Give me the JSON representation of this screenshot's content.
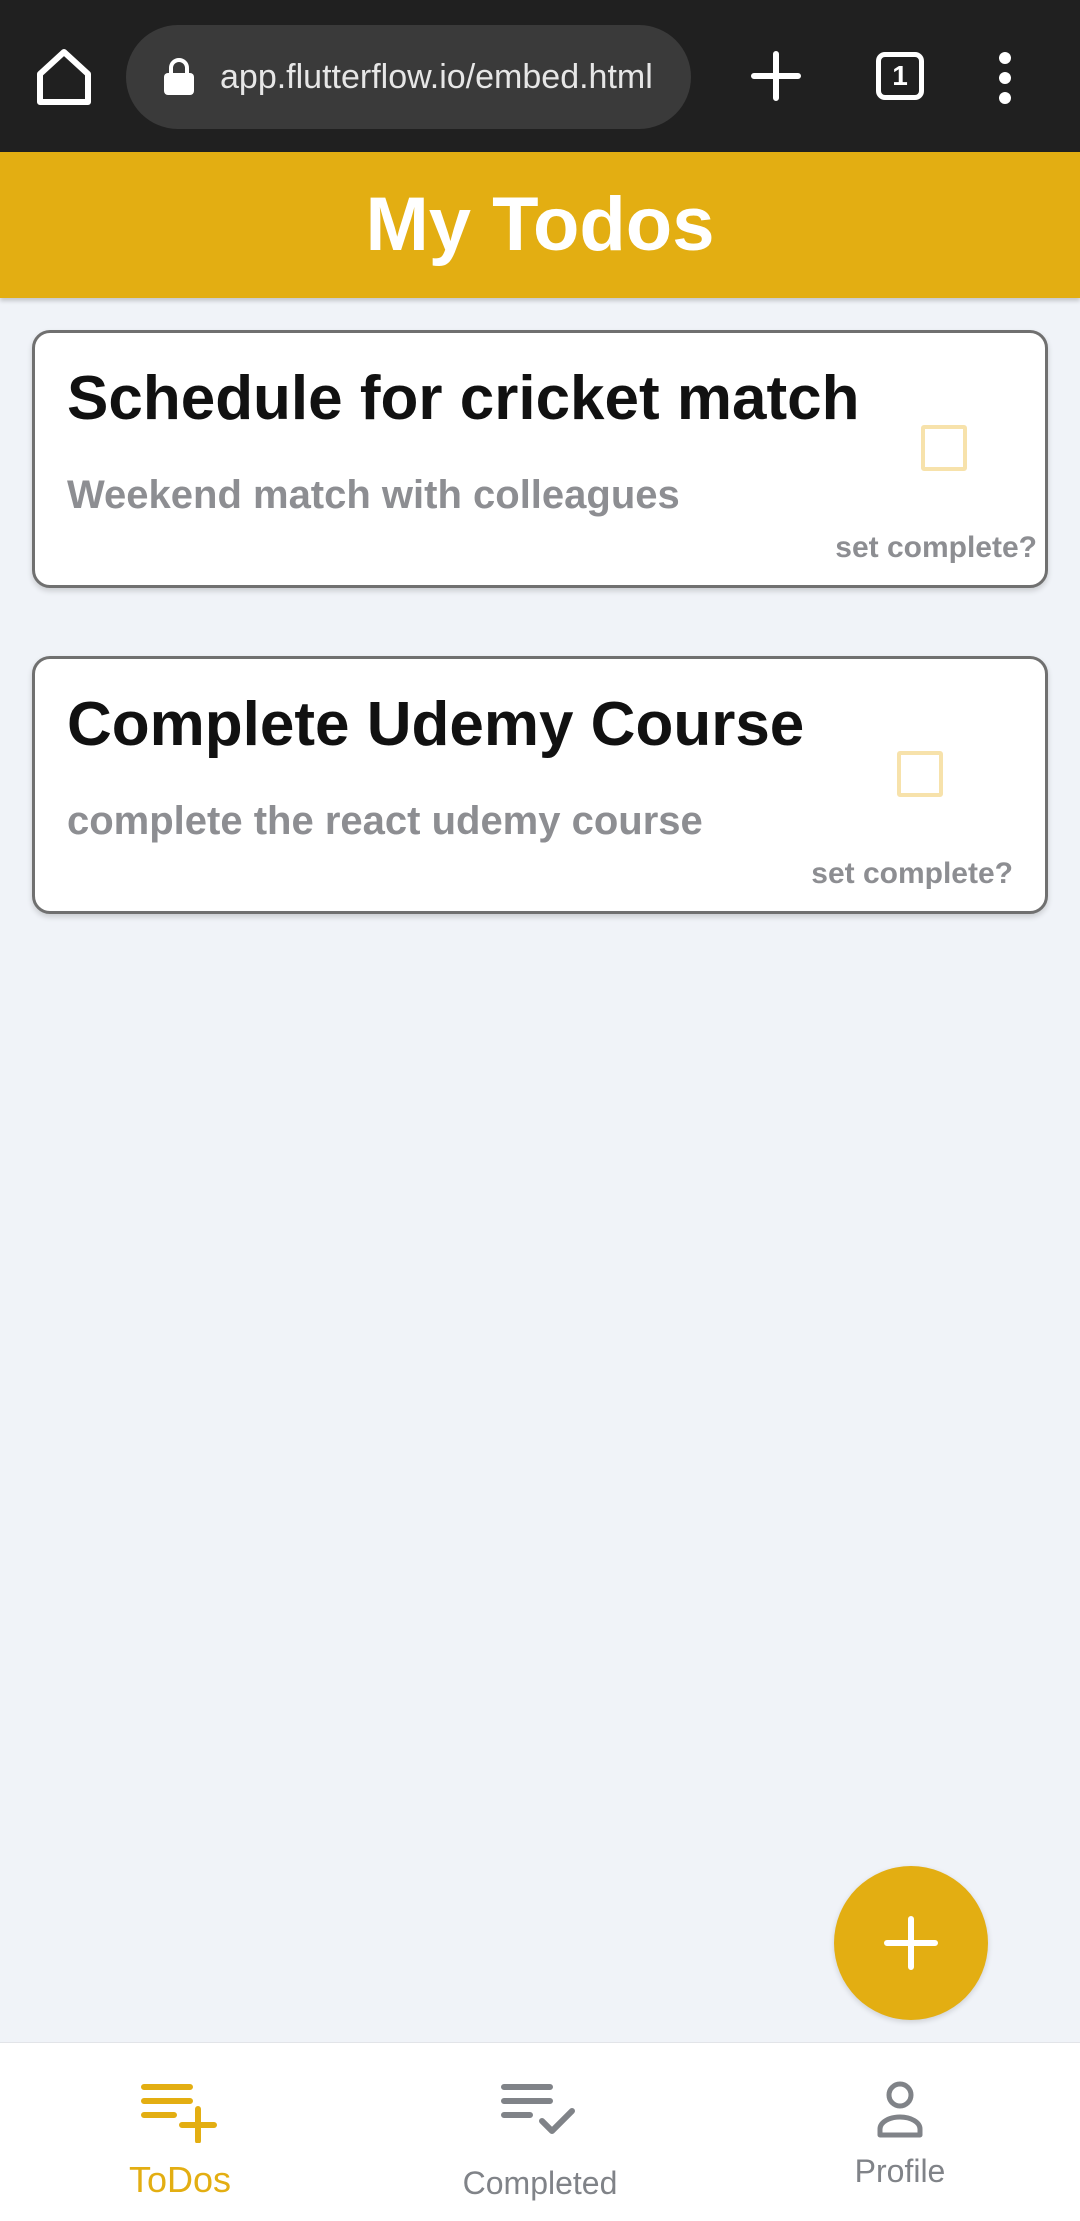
{
  "browser": {
    "url": "app.flutterflow.io/embed.html",
    "tab_count": "1",
    "icons": [
      "home-icon",
      "lock-icon",
      "plus-icon",
      "tab-switcher-icon",
      "more-vert-icon"
    ]
  },
  "header": {
    "title": "My Todos"
  },
  "todos": [
    {
      "title": "Schedule for cricket match",
      "description": "Weekend match with colleagues",
      "action_label": "set complete?",
      "completed": false
    },
    {
      "title": "Complete Udemy Course",
      "description": "complete the react udemy course",
      "action_label": "set complete?",
      "completed": false
    }
  ],
  "fab": {
    "icon": "add-icon"
  },
  "nav": {
    "items": [
      {
        "label": "ToDos",
        "icon": "playlist-add-icon",
        "active": true
      },
      {
        "label": "Completed",
        "icon": "playlist-check-icon",
        "active": false
      },
      {
        "label": "Profile",
        "icon": "person-icon",
        "active": false
      }
    ]
  },
  "colors": {
    "accent": "#e3ae12",
    "background": "#f0f3f8",
    "browser_bar": "#202020",
    "text_primary": "#111111",
    "text_secondary": "#8d8e92",
    "checkbox_border": "#f7e2ab",
    "nav_inactive": "#808388"
  }
}
